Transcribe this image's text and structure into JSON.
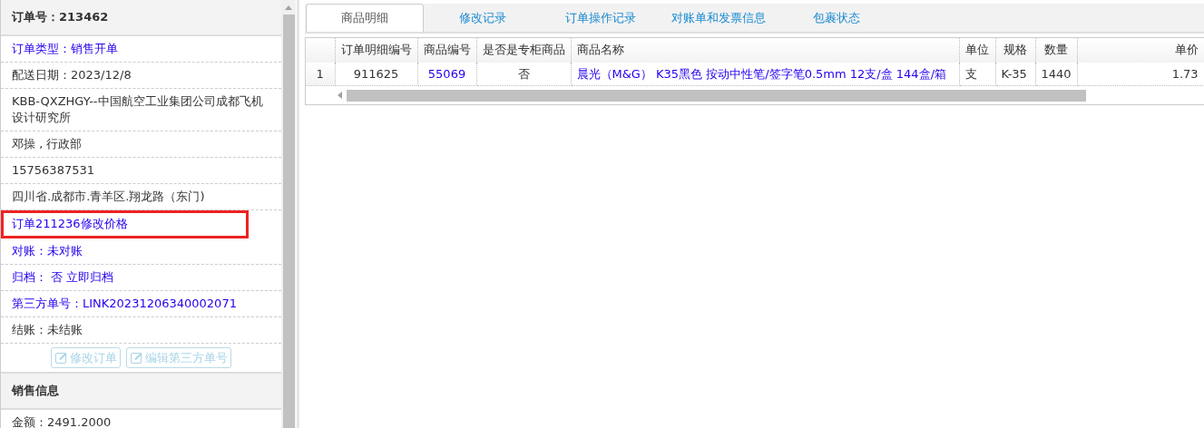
{
  "order_panel": {
    "title": "订单号：213462",
    "items": [
      {
        "text": "订单类型：销售开单",
        "kind": "link",
        "highlighted": false
      },
      {
        "text": "配送日期：2023/12/8",
        "kind": "text",
        "highlighted": false
      },
      {
        "text": "KBB-QXZHGY--中国航空工业集团公司成都飞机设计研究所",
        "kind": "text",
        "highlighted": false
      },
      {
        "text": "邓操 , 行政部",
        "kind": "text",
        "highlighted": false
      },
      {
        "text": "15756387531",
        "kind": "text",
        "highlighted": false
      },
      {
        "text": "四川省.成都市.青羊区.翔龙路（东门)",
        "kind": "text",
        "highlighted": false
      },
      {
        "text": "订单211236修改价格",
        "kind": "link",
        "highlighted": true
      },
      {
        "text": "对账：未对账",
        "kind": "link",
        "highlighted": false
      },
      {
        "text": "归档： 否 立即归档",
        "kind": "link",
        "highlighted": false
      },
      {
        "text": "第三方单号：LINK20231206340002071",
        "kind": "link",
        "highlighted": false
      },
      {
        "text": "结账：未结账",
        "kind": "text",
        "highlighted": false
      }
    ],
    "buttons": [
      {
        "label": "修改订单",
        "disabled": true
      },
      {
        "label": "编辑第三方单号",
        "disabled": true
      }
    ]
  },
  "sales_panel": {
    "title": "销售信息",
    "items": [
      "金额：2491.2000"
    ]
  },
  "tabs": [
    {
      "label": "商品明细",
      "selected": true
    },
    {
      "label": "修改记录",
      "selected": false
    },
    {
      "label": "订单操作记录",
      "selected": false
    },
    {
      "label": "对账单和发票信息",
      "selected": false
    },
    {
      "label": "包裹状态",
      "selected": false
    }
  ],
  "table": {
    "columns": [
      "订单明细编号",
      "商品编号",
      "是否是专柜商品",
      "商品名称",
      "单位",
      "规格",
      "数量",
      "单价"
    ],
    "rows": [
      {
        "index": "1",
        "cells": [
          "911625",
          "55069",
          "否",
          "晨光（M&G） K35黑色 按动中性笔/签字笔0.5mm 12支/盒 144盒/箱",
          "支",
          "K-35",
          "1440",
          "1.73"
        ]
      }
    ]
  }
}
